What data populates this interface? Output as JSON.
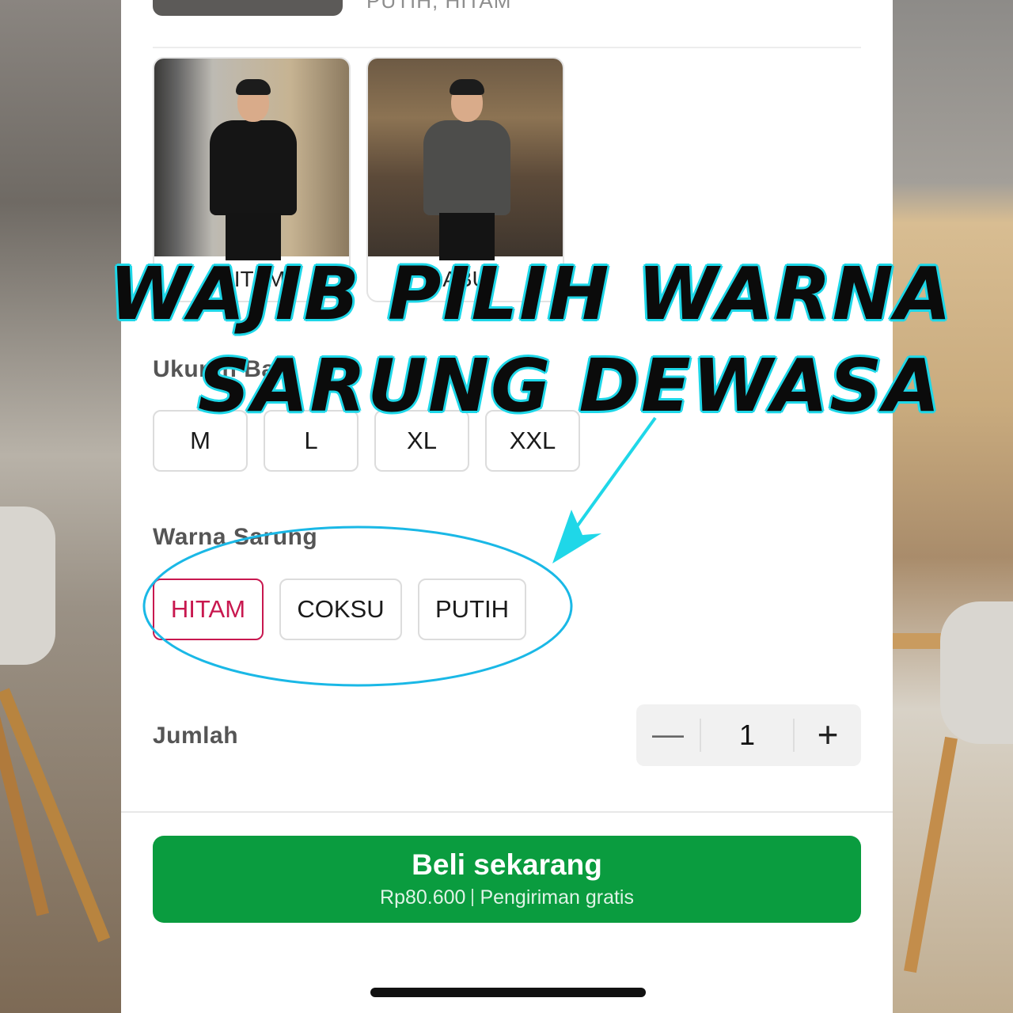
{
  "top_variant": {
    "label": "PUTIH, HITAM"
  },
  "variants": [
    {
      "name": "HITAM"
    },
    {
      "name": "ABU"
    }
  ],
  "size_section": {
    "label": "Ukuran Baju",
    "options": [
      "M",
      "L",
      "XL",
      "XXL"
    ]
  },
  "color_section": {
    "label": "Warna Sarung",
    "options": [
      "HITAM",
      "COKSU",
      "PUTIH"
    ],
    "selected": "HITAM"
  },
  "quantity": {
    "label": "Jumlah",
    "value": "1",
    "minus_symbol": "—",
    "plus_symbol": "+"
  },
  "buy_button": {
    "title": "Beli sekarang",
    "price": "Rp80.600",
    "shipping": "Pengiriman gratis"
  },
  "overlay": {
    "line1": "WAJIB PILIH WARNA",
    "line2": "SARUNG DEWASA"
  },
  "colors": {
    "accent_selected": "#c8184f",
    "buy_green": "#0a9c3f",
    "overlay_cyan": "#1fd7e8"
  }
}
